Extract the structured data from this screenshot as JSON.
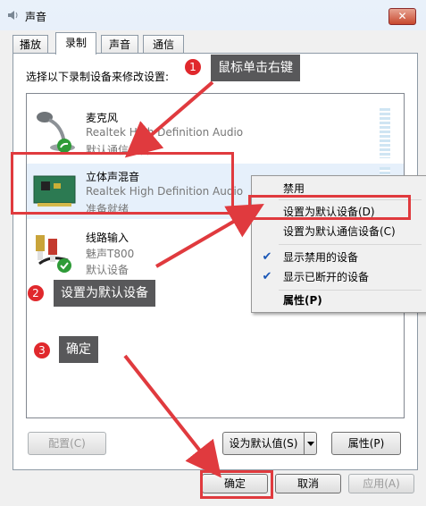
{
  "window": {
    "title": "声音",
    "close_glyph": "✕"
  },
  "tabs": [
    {
      "label": "播放"
    },
    {
      "label": "录制"
    },
    {
      "label": "声音"
    },
    {
      "label": "通信"
    }
  ],
  "instruction": "选择以下录制设备来修改设置:",
  "devices": [
    {
      "name": "麦克风",
      "driver": "Realtek High Definition Audio",
      "status": "默认通信设备",
      "icon": "microphone-icon",
      "badge": "phone-icon"
    },
    {
      "name": "立体声混音",
      "driver": "Realtek High Definition Audio",
      "status": "准备就绪",
      "icon": "sound-card-icon"
    },
    {
      "name": "线路输入",
      "driver": "魅声T800",
      "status": "默认设备",
      "icon": "rca-cable-icon",
      "badge": "check-icon"
    }
  ],
  "buttons": {
    "configure": "配置(C)",
    "set_default": "设为默认值(S)",
    "properties": "属性(P)",
    "ok": "确定",
    "cancel": "取消",
    "apply": "应用(A)"
  },
  "context_menu": {
    "items": [
      {
        "label": "禁用",
        "checked": false
      },
      {
        "label": "设置为默认设备(D)",
        "checked": false
      },
      {
        "label": "设置为默认通信设备(C)",
        "checked": false
      },
      {
        "label": "显示禁用的设备",
        "checked": true
      },
      {
        "label": "显示已断开的设备",
        "checked": true
      },
      {
        "label": "属性(P)",
        "checked": false
      }
    ]
  },
  "annotations": [
    {
      "number": "1",
      "text": "鼠标单击右键"
    },
    {
      "number": "2",
      "text": "设置为默认设备"
    },
    {
      "number": "3",
      "text": "确定"
    }
  ],
  "colors": {
    "annotation_red": "#e03a3e",
    "callout_bg": "#58585a",
    "selection": "#e6f0fb"
  }
}
